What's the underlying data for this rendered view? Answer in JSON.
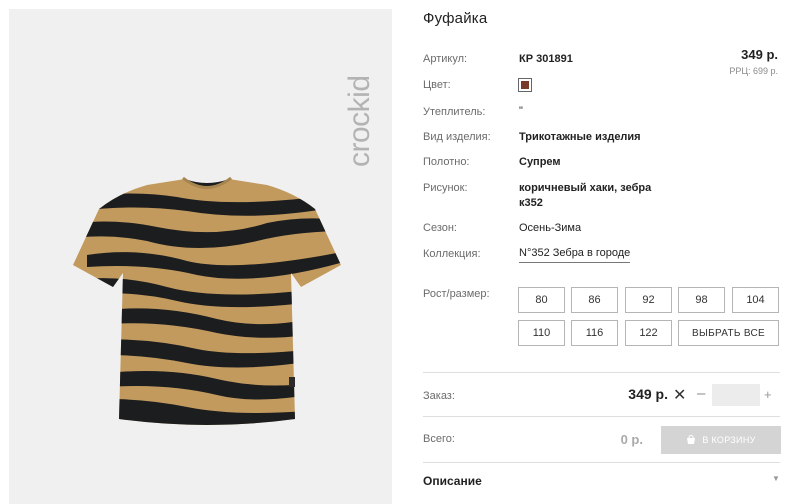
{
  "brand": {
    "logo_text": "crockid"
  },
  "product": {
    "title": "Фуфайка",
    "price": "349 р.",
    "rrp": "РРЦ: 699 р."
  },
  "specs": {
    "article_label": "Артикул:",
    "article_value": "КР 301891",
    "color_label": "Цвет:",
    "color_hex": "#7a3a2a",
    "insulation_label": "Утеплитель:",
    "insulation_value": "\"",
    "type_label": "Вид изделия:",
    "type_value": "Трикотажные изделия",
    "fabric_label": "Полотно:",
    "fabric_value": "Супрем",
    "pattern_label": "Рисунок:",
    "pattern_value_line1": "коричневый хаки, зебра",
    "pattern_value_line2": "к352",
    "season_label": "Сезон:",
    "season_value": "Осень-Зима",
    "collection_label": "Коллекция:",
    "collection_value": "N°352 Зебра в городе"
  },
  "sizes": {
    "label": "Рост/размер:",
    "options": [
      "80",
      "86",
      "92",
      "98",
      "104",
      "110",
      "116",
      "122"
    ],
    "select_all": "ВЫБРАТЬ ВСЕ"
  },
  "order": {
    "label": "Заказ:",
    "price": "349 р.",
    "remove": "✕",
    "minus": "–",
    "plus": "+",
    "quantity": ""
  },
  "total": {
    "label": "Всего:",
    "value": "0 р.",
    "cart_button": "В КОРЗИНУ"
  },
  "description": {
    "title": "Описание"
  },
  "colors": {
    "fabric_tan": "#c29a5e",
    "stripe": "#1c1d1f",
    "panel_bg": "#f0f0f0",
    "logo_gray": "#b3b3b3"
  }
}
